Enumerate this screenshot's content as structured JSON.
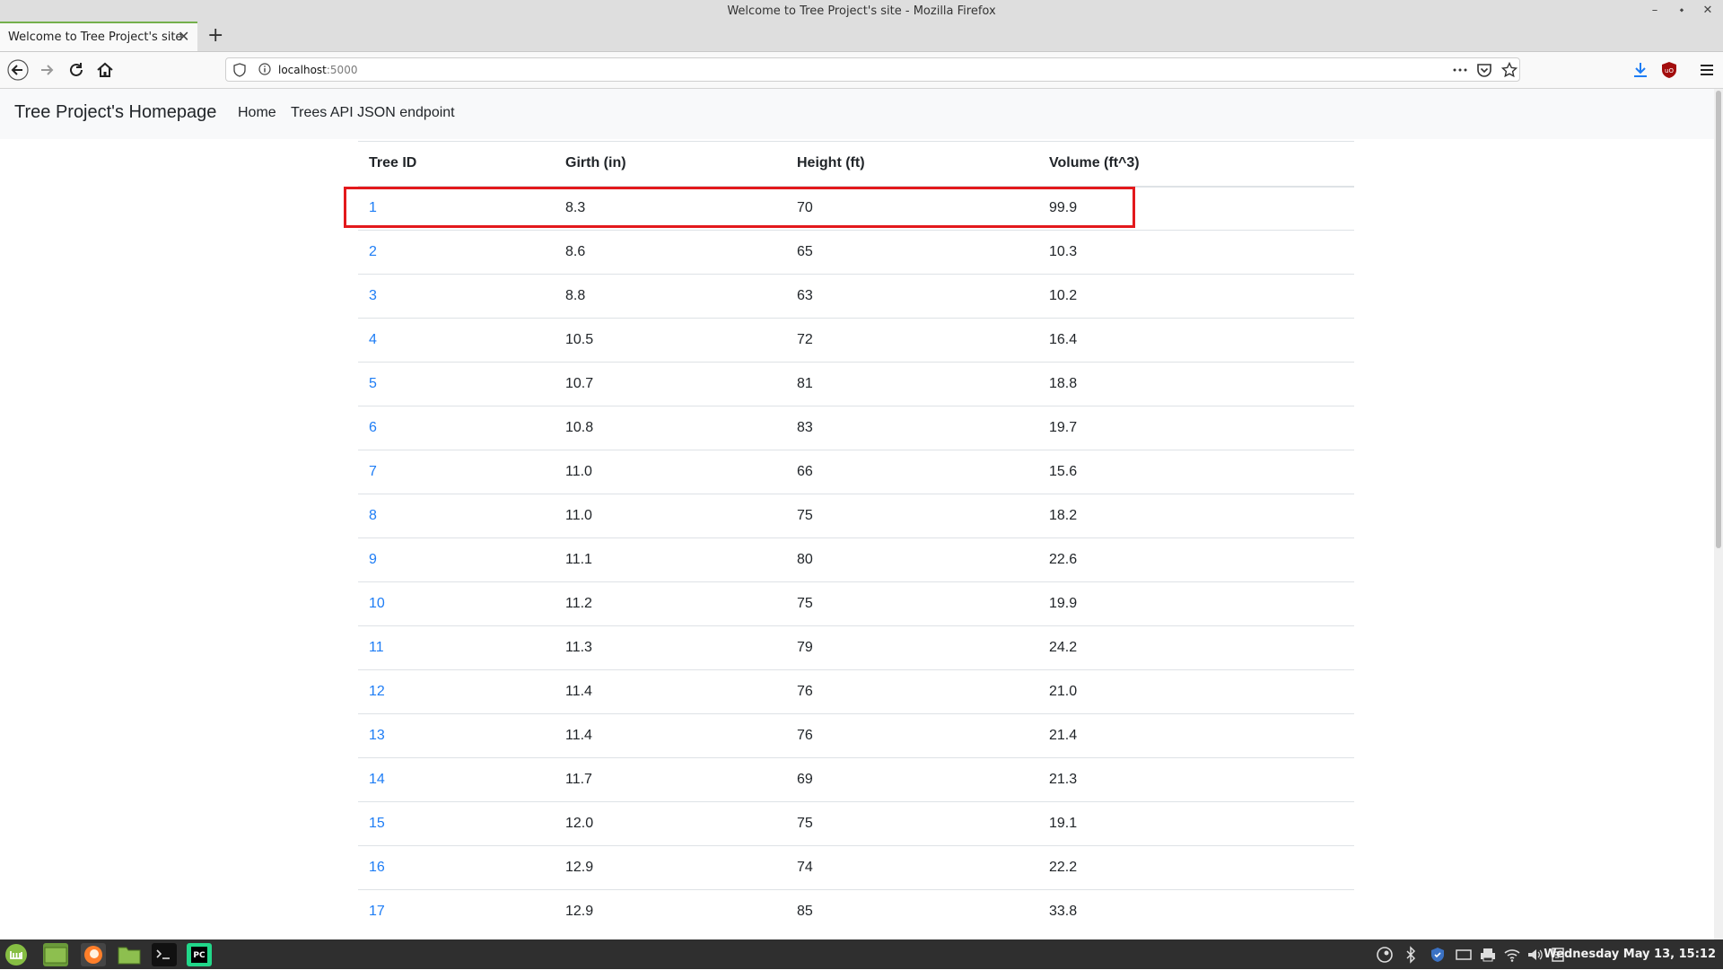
{
  "window": {
    "title": "Welcome to Tree Project's site - Mozilla Firefox",
    "minimize": "–",
    "restore": "⬩",
    "close": "✕"
  },
  "tabs": [
    {
      "title": "Welcome to Tree Project's site",
      "close": "✕",
      "active": true
    }
  ],
  "new_tab": "+",
  "urlbar": {
    "host": "localhost",
    "port": ":5000"
  },
  "site": {
    "brand": "Tree Project's Homepage",
    "nav": [
      "Home",
      "Trees API JSON endpoint"
    ]
  },
  "table": {
    "headers": [
      "Tree ID",
      "Girth (in)",
      "Height (ft)",
      "Volume (ft^3)"
    ],
    "rows": [
      [
        "1",
        "8.3",
        "70",
        "99.9"
      ],
      [
        "2",
        "8.6",
        "65",
        "10.3"
      ],
      [
        "3",
        "8.8",
        "63",
        "10.2"
      ],
      [
        "4",
        "10.5",
        "72",
        "16.4"
      ],
      [
        "5",
        "10.7",
        "81",
        "18.8"
      ],
      [
        "6",
        "10.8",
        "83",
        "19.7"
      ],
      [
        "7",
        "11.0",
        "66",
        "15.6"
      ],
      [
        "8",
        "11.0",
        "75",
        "18.2"
      ],
      [
        "9",
        "11.1",
        "80",
        "22.6"
      ],
      [
        "10",
        "11.2",
        "75",
        "19.9"
      ],
      [
        "11",
        "11.3",
        "79",
        "24.2"
      ],
      [
        "12",
        "11.4",
        "76",
        "21.0"
      ],
      [
        "13",
        "11.4",
        "76",
        "21.4"
      ],
      [
        "14",
        "11.7",
        "69",
        "21.3"
      ],
      [
        "15",
        "12.0",
        "75",
        "19.1"
      ],
      [
        "16",
        "12.9",
        "74",
        "22.2"
      ],
      [
        "17",
        "12.9",
        "85",
        "33.8"
      ]
    ],
    "highlighted_row": 0
  },
  "taskbar": {
    "clock": "Wednesday May 13, 15:12",
    "apps": [
      "mint-menu-icon",
      "show-desktop-icon",
      "firefox-icon",
      "files-icon",
      "terminal-icon",
      "pycharm-icon"
    ]
  },
  "colors": {
    "link": "#1e7df5",
    "highlight": "#e3191c",
    "tab_accent": "#74b04c"
  }
}
